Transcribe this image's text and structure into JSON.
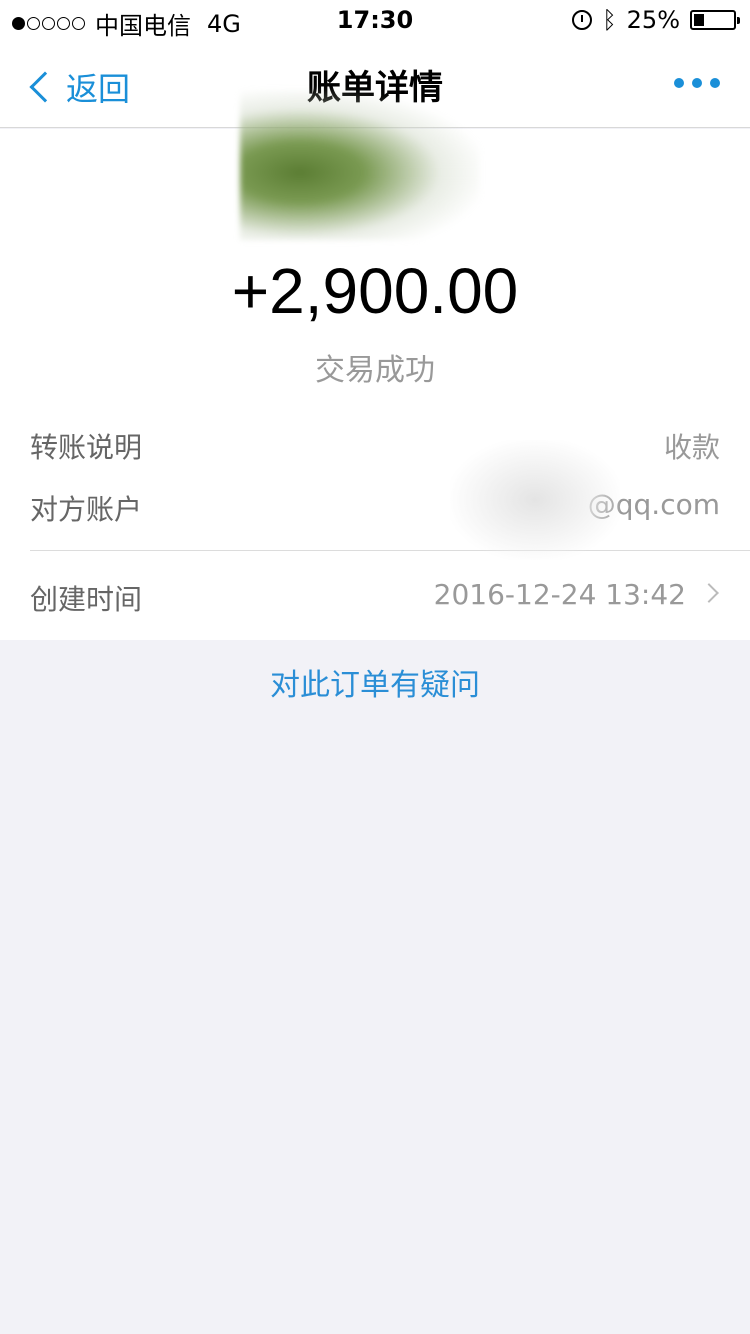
{
  "status_bar": {
    "carrier": "中国电信",
    "network": "4G",
    "time": "17:30",
    "battery_text": "25%",
    "battery_level": 0.25,
    "signal_bars_filled": 1,
    "signal_bars_total": 5
  },
  "nav": {
    "back_label": "返回",
    "title": "账单详情",
    "more_icon": "more-icon"
  },
  "summary": {
    "amount": "+2,900.00",
    "status": "交易成功"
  },
  "details": {
    "memo_label": "转账说明",
    "memo_value": "收款",
    "account_label": "对方账户",
    "account_value": "@qq.com",
    "created_label": "创建时间",
    "created_value": "2016-12-24 13:42"
  },
  "help": {
    "question_link": "对此订单有疑问"
  },
  "colors": {
    "accent": "#1a8fd8",
    "background": "#f2f2f7"
  }
}
